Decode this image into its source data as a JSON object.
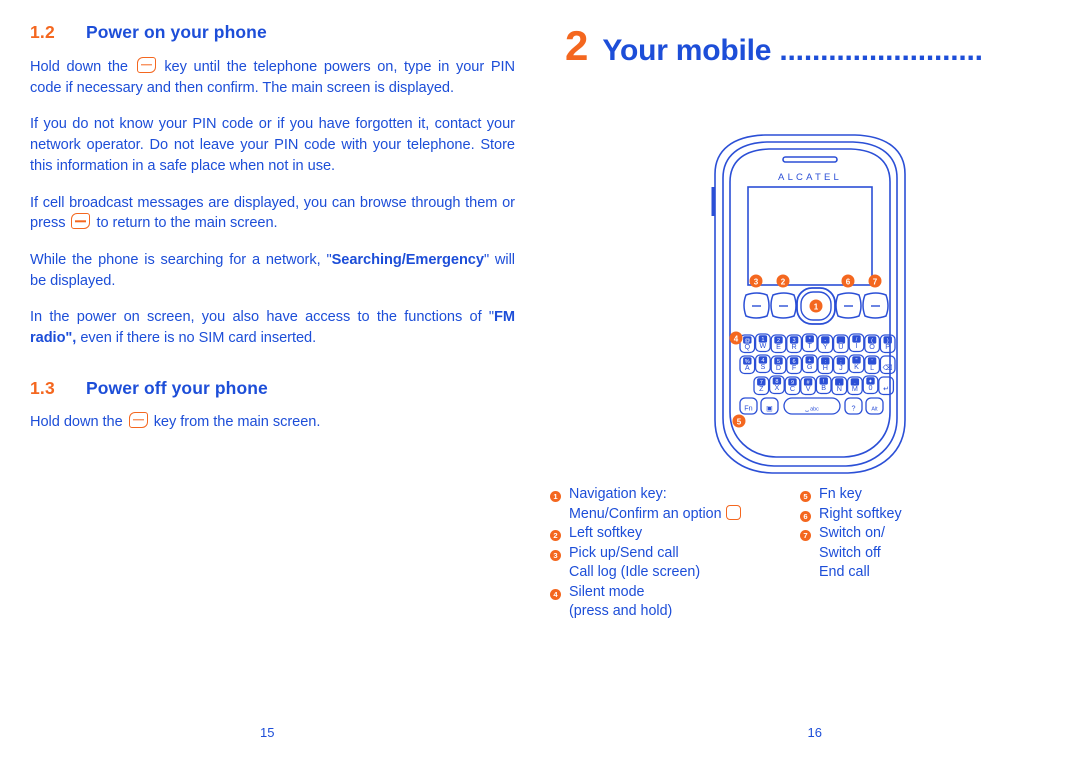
{
  "colors": {
    "blue": "#1d4ed8",
    "orange": "#f4671f",
    "white": "#ffffff"
  },
  "left_page": {
    "page_number": "15",
    "sections": [
      {
        "number": "1.2",
        "title": "Power on your phone",
        "paragraphs": [
          {
            "before": "Hold down the",
            "glyph": "end-call-key-icon",
            "after": "key until the telephone powers on, type in your PIN code if necessary and then confirm. The main screen is displayed."
          },
          {
            "text": "If you do not know your PIN code or if you have forgotten it, contact your network operator. Do not leave your PIN code with your telephone. Store this information in a safe place when not in use."
          },
          {
            "before": "If cell broadcast messages are displayed, you can browse through them or press",
            "glyph": "end-call-key-icon",
            "after": "to return to the main screen."
          },
          {
            "before": "While the phone is searching for a network, \"",
            "bold": "Searching/Emergency",
            "after": "\" will be displayed."
          },
          {
            "before": "In the power on screen, you also have access to the functions of \"",
            "bold": "FM radio\",",
            "after": "even if there is no SIM card inserted."
          }
        ]
      },
      {
        "number": "1.3",
        "title": "Power off your phone",
        "paragraphs": [
          {
            "before": "Hold down the",
            "glyph": "end-call-key-icon",
            "after": "key from the main screen."
          }
        ]
      }
    ]
  },
  "right_page": {
    "page_number": "16",
    "chapter": {
      "number": "2",
      "title": "Your mobile ........................."
    },
    "phone": {
      "brand": "ALCATEL",
      "callouts": [
        "1",
        "2",
        "3",
        "4",
        "5",
        "6",
        "7"
      ],
      "keyboard": {
        "row1": [
          {
            "main": "Q",
            "alt": "@"
          },
          {
            "main": "W",
            "alt": "1"
          },
          {
            "main": "E",
            "alt": "2"
          },
          {
            "main": "R",
            "alt": "3"
          },
          {
            "main": "T",
            "alt": "*"
          },
          {
            "main": "Y",
            "alt": "-"
          },
          {
            "main": "U",
            "alt": "_"
          },
          {
            "main": "I",
            "alt": "/"
          },
          {
            "main": "O",
            "alt": "("
          },
          {
            "main": "P",
            "alt": ")"
          }
        ],
        "row2": [
          {
            "main": "A",
            "alt": "%"
          },
          {
            "main": "S",
            "alt": "4"
          },
          {
            "main": "D",
            "alt": "5"
          },
          {
            "main": "F",
            "alt": "6"
          },
          {
            "main": "G",
            "alt": "+"
          },
          {
            "main": "H",
            "alt": ":"
          },
          {
            "main": "J",
            "alt": ";"
          },
          {
            "main": "K",
            "alt": "\""
          },
          {
            "main": "L",
            "alt": "'"
          },
          {
            "main": "⌫",
            "alt": ""
          }
        ],
        "row3": [
          {
            "main": "Z",
            "alt": "7"
          },
          {
            "main": "X",
            "alt": "8"
          },
          {
            "main": "C",
            "alt": "9"
          },
          {
            "main": "V",
            "alt": "#"
          },
          {
            "main": "B",
            "alt": "!"
          },
          {
            "main": "N",
            "alt": ","
          },
          {
            "main": "M",
            "alt": "."
          },
          {
            "main": "0",
            "alt": "✦"
          },
          {
            "main": "↵",
            "alt": ""
          }
        ],
        "row4": [
          {
            "main": "Fn",
            "alt": ""
          },
          {
            "main": "▣",
            "alt": ","
          },
          {
            "main": "␣ abc",
            "alt": ""
          },
          {
            "main": "?",
            "alt": "."
          },
          {
            "main": "Alt",
            "alt": ""
          }
        ]
      }
    },
    "legend": {
      "column1": [
        {
          "num": "1",
          "lines": [
            "Navigation key:",
            "Menu/Confirm an option"
          ],
          "glyph": "nav-key-icon"
        },
        {
          "num": "2",
          "lines": [
            "Left softkey"
          ]
        },
        {
          "num": "3",
          "lines": [
            "Pick up/Send call",
            "Call log (Idle screen)"
          ]
        },
        {
          "num": "4",
          "lines": [
            "Silent mode",
            "(press and hold)"
          ]
        }
      ],
      "column2": [
        {
          "num": "5",
          "lines": [
            "Fn key"
          ]
        },
        {
          "num": "6",
          "lines": [
            "Right softkey"
          ]
        },
        {
          "num": "7",
          "lines": [
            "Switch on/",
            "Switch off",
            "End call"
          ]
        }
      ]
    }
  }
}
